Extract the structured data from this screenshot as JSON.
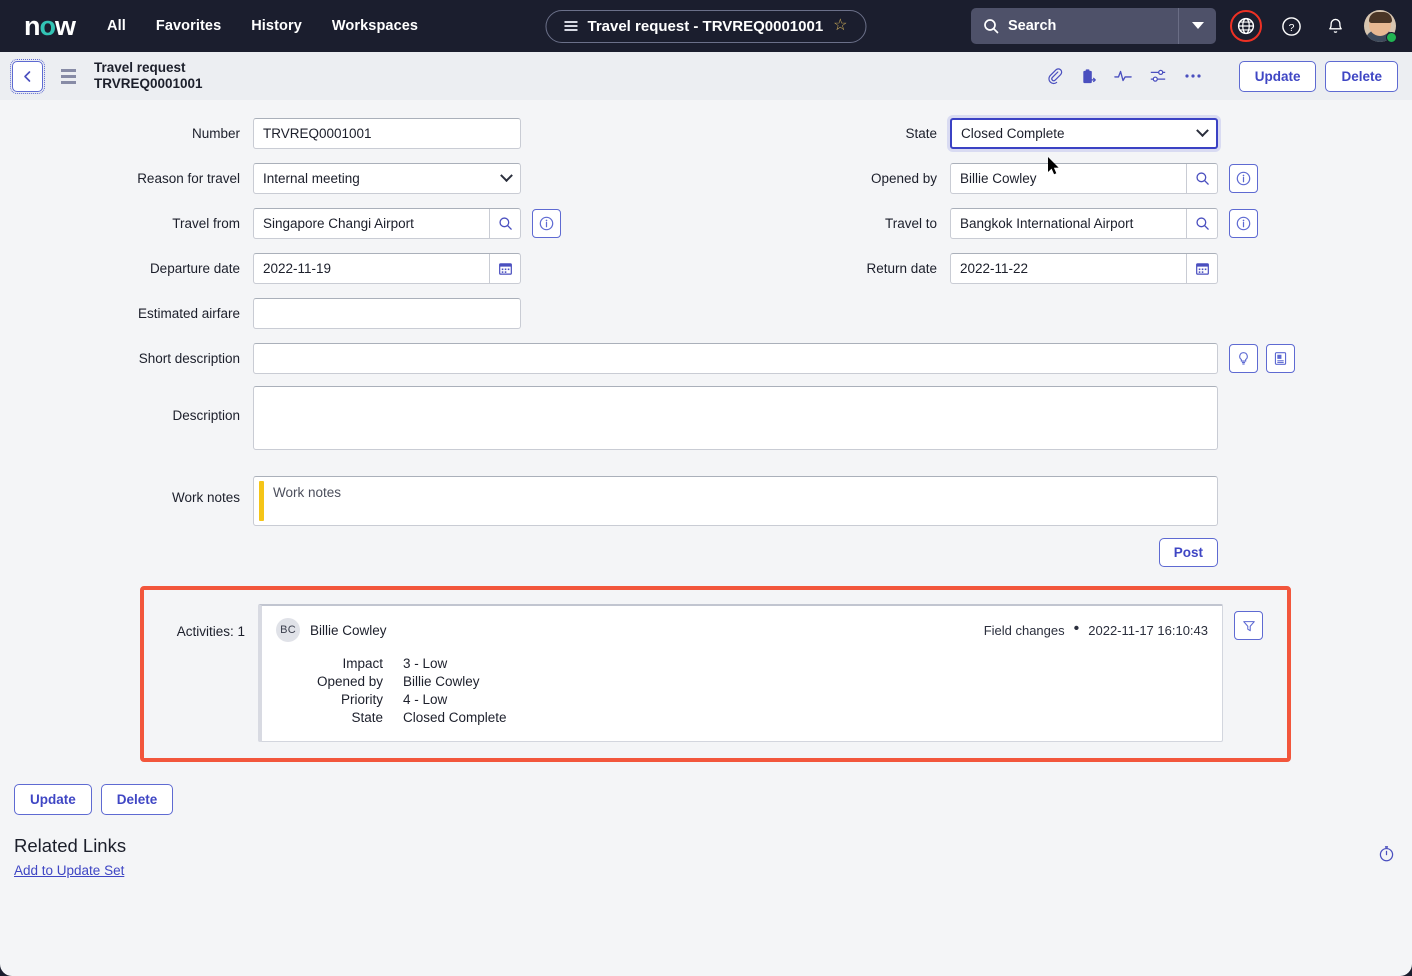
{
  "topnav": {
    "logo": "now",
    "links": [
      "All",
      "Favorites",
      "History",
      "Workspaces"
    ],
    "record_pill": "Travel request - TRVREQ0001001",
    "search_placeholder": "Search",
    "accent_red": "#ee3124",
    "brand_teal": "#32c3b4"
  },
  "record_toolbar": {
    "title_line1": "Travel request",
    "title_line2": "TRVREQ0001001",
    "update_label": "Update",
    "delete_label": "Delete"
  },
  "form": {
    "number": {
      "label": "Number",
      "value": "TRVREQ0001001"
    },
    "reason": {
      "label": "Reason for travel",
      "value": "Internal meeting"
    },
    "travel_from": {
      "label": "Travel from",
      "value": "Singapore Changi Airport"
    },
    "departure": {
      "label": "Departure date",
      "value": "2022-11-19"
    },
    "airfare": {
      "label": "Estimated airfare",
      "value": ""
    },
    "state": {
      "label": "State",
      "value": "Closed Complete"
    },
    "opened_by": {
      "label": "Opened by",
      "value": "Billie Cowley"
    },
    "travel_to": {
      "label": "Travel to",
      "value": "Bangkok International Airport"
    },
    "return_date": {
      "label": "Return date",
      "value": "2022-11-22"
    },
    "short_description": {
      "label": "Short description",
      "value": ""
    },
    "description": {
      "label": "Description",
      "value": ""
    },
    "work_notes": {
      "label": "Work notes",
      "placeholder": "Work notes"
    },
    "post_label": "Post"
  },
  "activities": {
    "label": "Activities: 1",
    "highlight_color": "#f2563c",
    "entry": {
      "initials": "BC",
      "author": "Billie Cowley",
      "type": "Field changes",
      "separator": "•",
      "timestamp": "2022-11-17 16:10:43",
      "changes": [
        {
          "field": "Impact",
          "value": "3 - Low"
        },
        {
          "field": "Opened by",
          "value": "Billie Cowley"
        },
        {
          "field": "Priority",
          "value": "4 - Low"
        },
        {
          "field": "State",
          "value": "Closed Complete"
        }
      ]
    }
  },
  "footer": {
    "update_label": "Update",
    "delete_label": "Delete",
    "related_links_title": "Related Links",
    "add_to_update_set": "Add to Update Set"
  }
}
